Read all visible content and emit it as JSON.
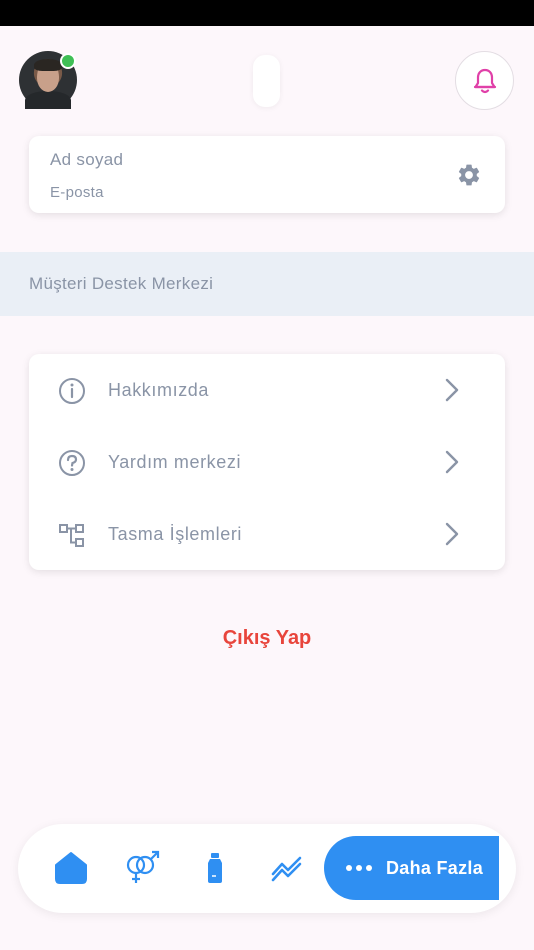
{
  "profile": {
    "name_placeholder": "Ad soyad",
    "email_placeholder": "E-posta"
  },
  "section": {
    "title": "Müşteri Destek Merkezi"
  },
  "menu": {
    "items": [
      {
        "label": "Hakkımızda",
        "icon": "info-icon"
      },
      {
        "label": "Yardım merkezi",
        "icon": "help-icon"
      },
      {
        "label": "Tasma İşlemleri",
        "icon": "hierarchy-icon"
      }
    ]
  },
  "logout": {
    "label": "Çıkış Yap"
  },
  "bottom_nav": {
    "more_label": "Daha Fazla",
    "items": [
      "home-icon",
      "gender-icon",
      "bottle-icon",
      "chart-icon",
      "more-icon"
    ]
  },
  "colors": {
    "accent_blue": "#2f8ff2",
    "logout_red": "#e8453c",
    "bell_pink": "#e040a8",
    "online_green": "#3fbf55",
    "text_gray": "#8a94a6"
  }
}
